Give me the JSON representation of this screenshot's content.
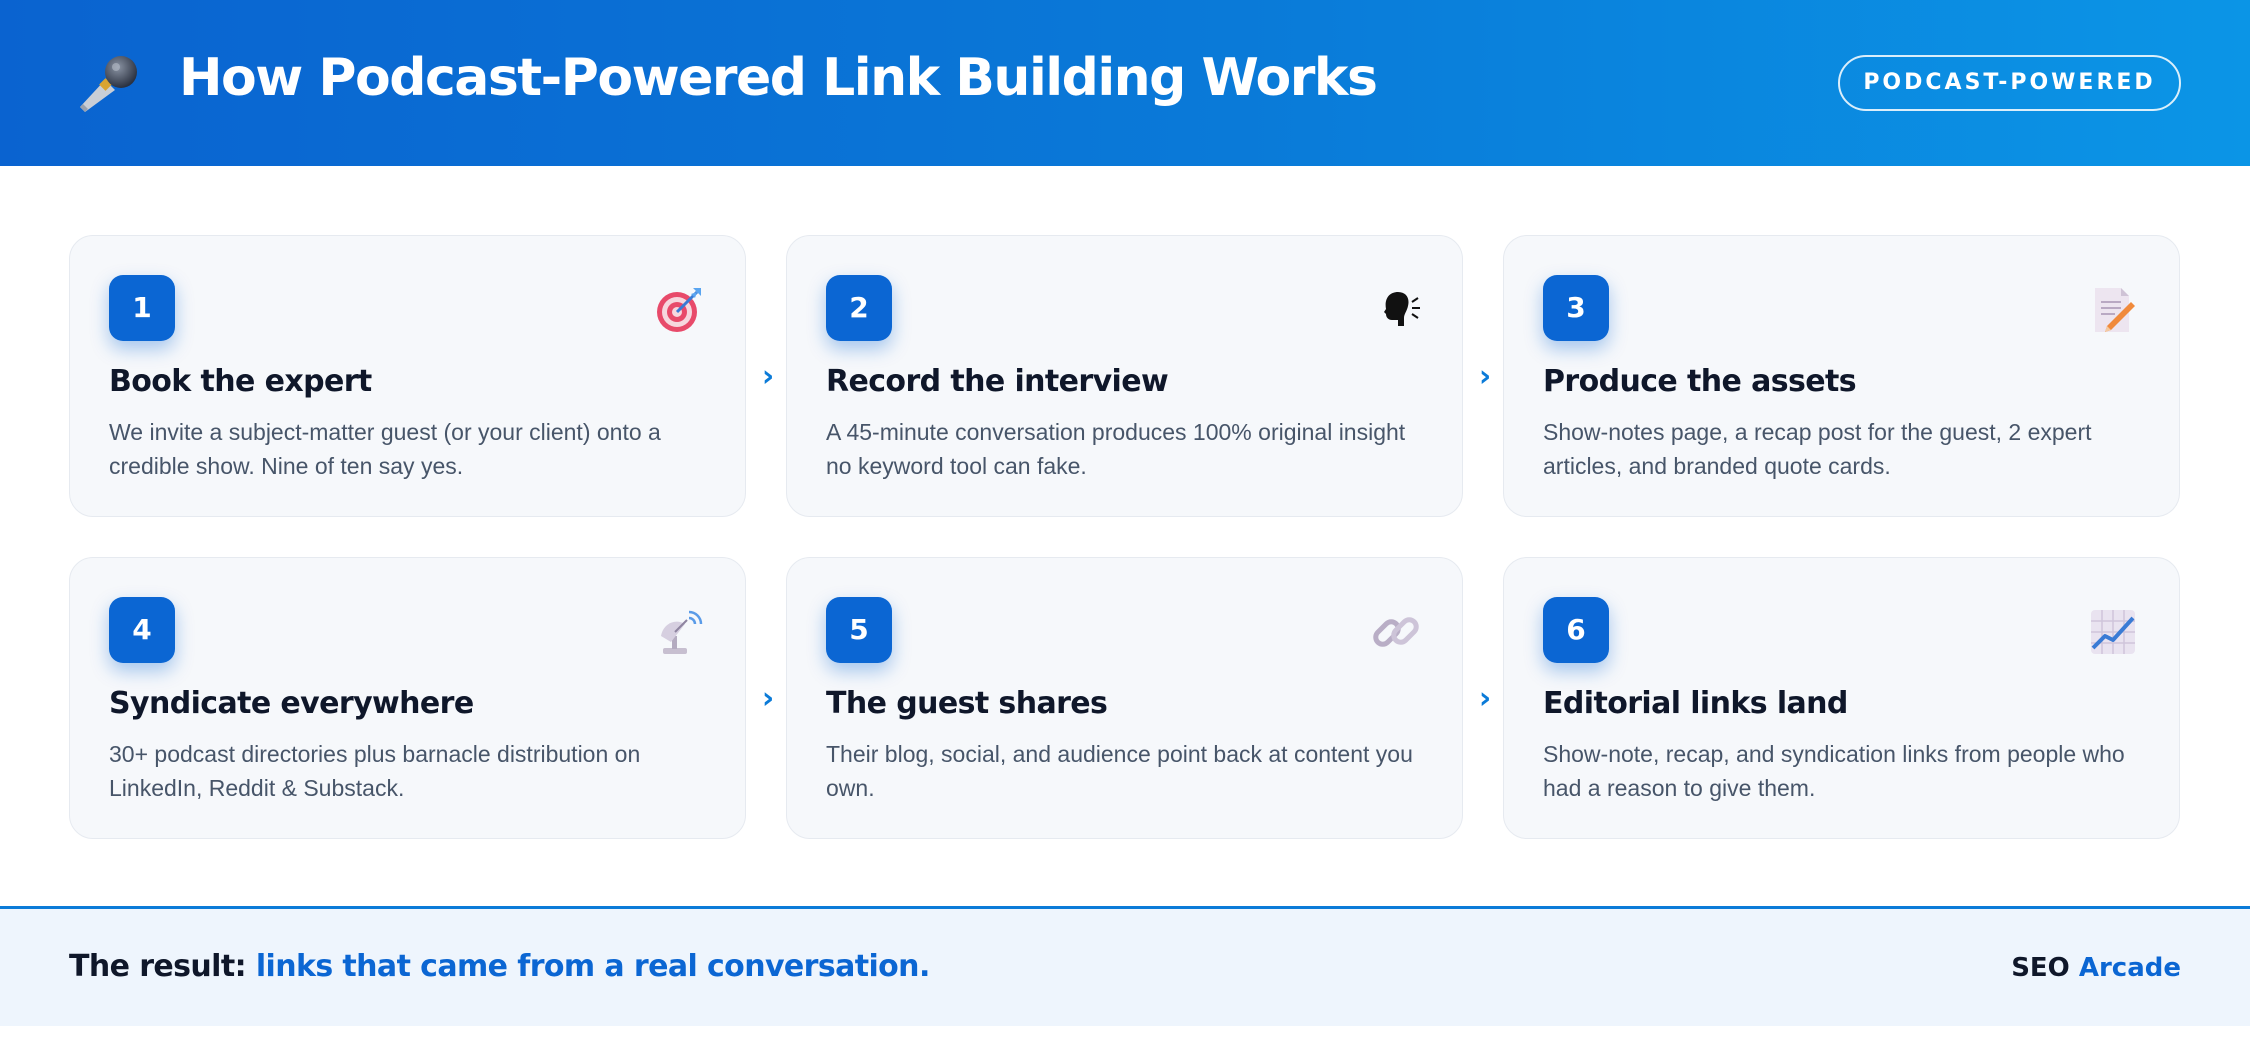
{
  "header": {
    "icon": "microphone-icon",
    "title": "How Podcast-Powered Link Building Works",
    "badge": "PODCAST-POWERED"
  },
  "steps": [
    {
      "number": "1",
      "icon": "target-icon",
      "title": "Book the expert",
      "description": "We invite a subject-matter guest (or your client) onto a credible show. Nine of ten say yes."
    },
    {
      "number": "2",
      "icon": "speaking-head-icon",
      "title": "Record the interview",
      "description": "A 45-minute conversation produces 100% original insight no keyword tool can fake."
    },
    {
      "number": "3",
      "icon": "memo-pencil-icon",
      "title": "Produce the assets",
      "description": "Show-notes page, a recap post for the guest, 2 expert articles, and branded quote cards."
    },
    {
      "number": "4",
      "icon": "satellite-dish-icon",
      "title": "Syndicate everywhere",
      "description": "30+ podcast directories plus barnacle distribution on LinkedIn, Reddit & Substack."
    },
    {
      "number": "5",
      "icon": "link-icon",
      "title": "The guest shares",
      "description": "Their blog, social, and audience point back at content you own."
    },
    {
      "number": "6",
      "icon": "chart-increasing-icon",
      "title": "Editorial links land",
      "description": "Show-note, recap, and syndication links from people who had a reason to give them."
    }
  ],
  "arrow_glyph": "›",
  "footer": {
    "lead": "The result:",
    "accent": "links that came from a real conversation.",
    "brand_part1": "SEO",
    "brand_part2": "Arcade"
  },
  "colors": {
    "primary": "#0b66d3",
    "header_gradient_start": "#0a63d0",
    "header_gradient_end": "#0b95e6",
    "card_bg": "#f6f8fb",
    "footer_bg": "#eef5fd",
    "text_dark": "#0f172a",
    "text_muted": "#475569"
  }
}
